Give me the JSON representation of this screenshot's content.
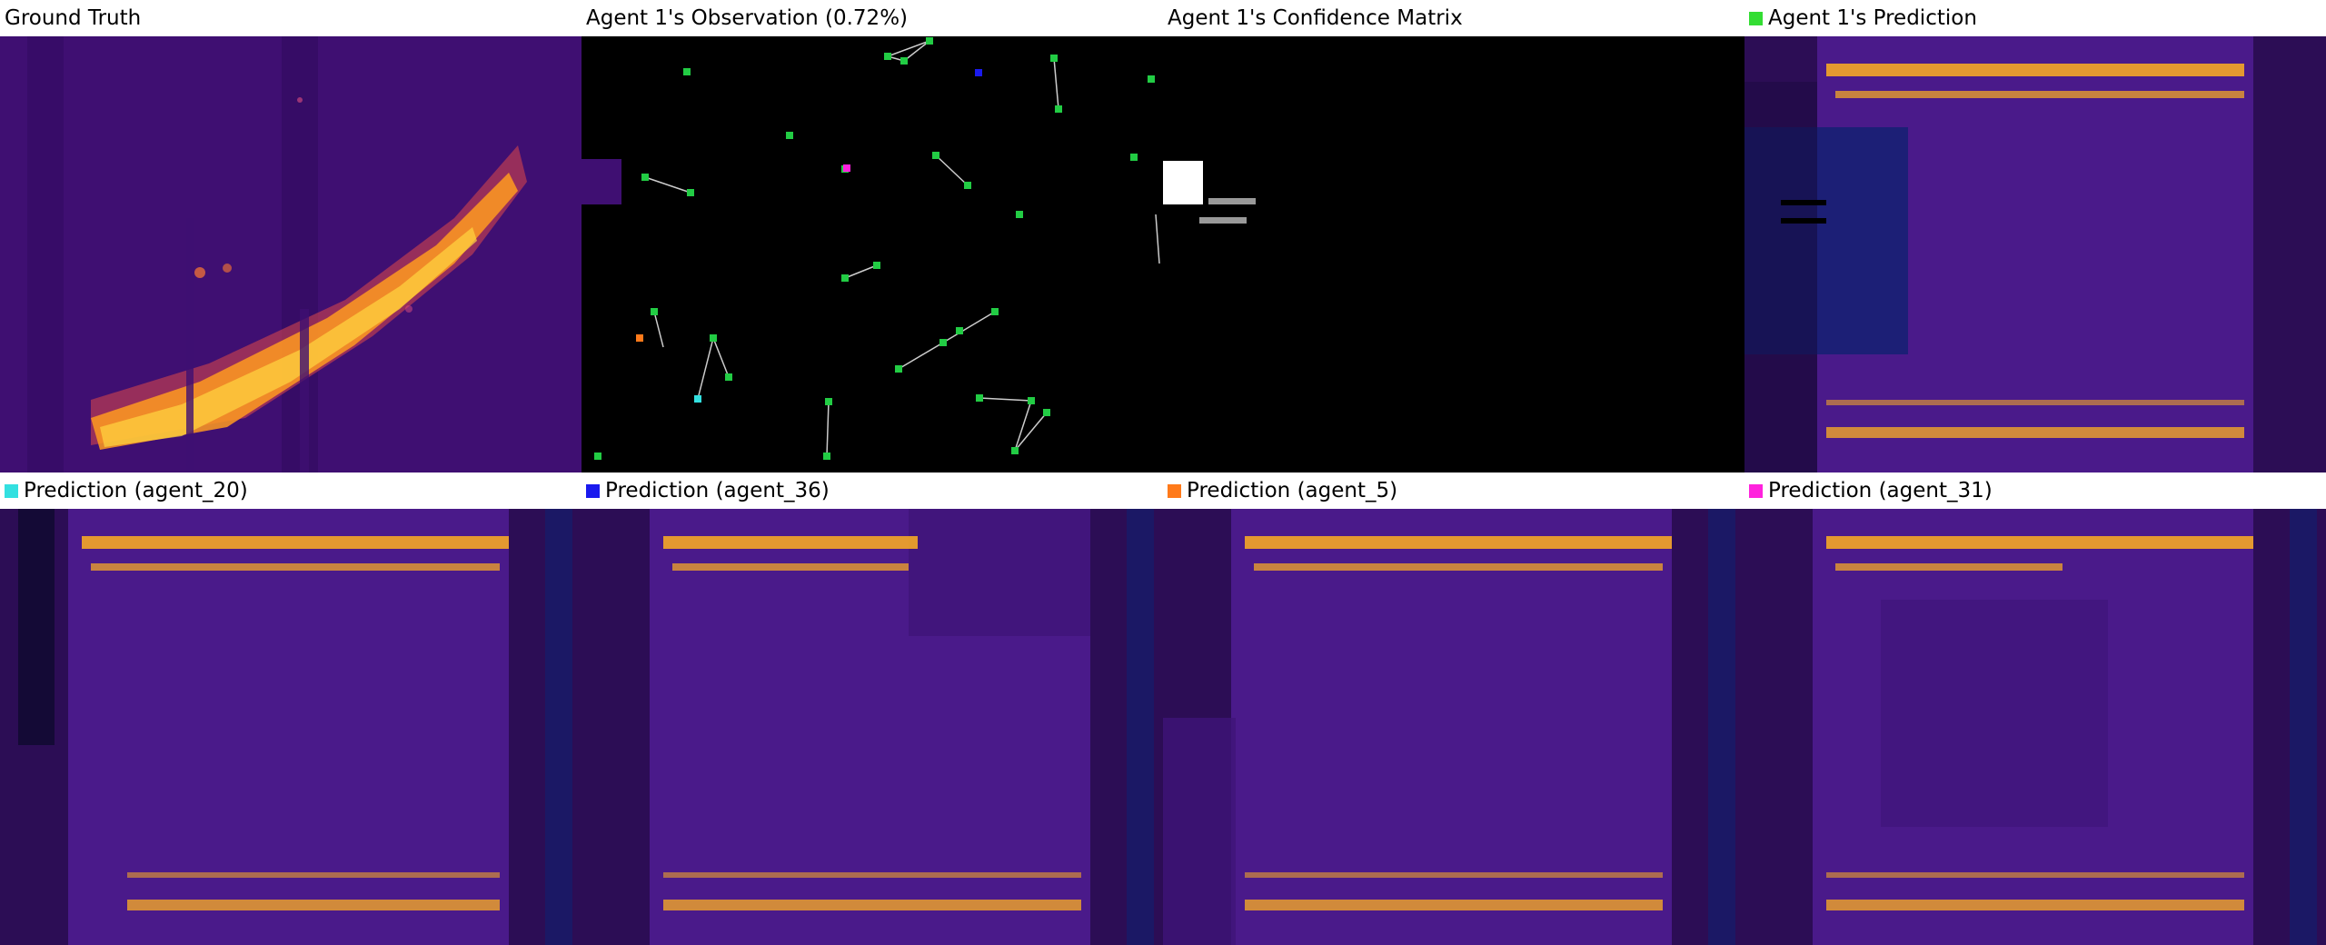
{
  "panels": [
    {
      "title": "Ground Truth",
      "swatch": null,
      "kind": "ground-truth"
    },
    {
      "title": "Agent 1's Observation (0.72%)",
      "swatch": null,
      "kind": "observation"
    },
    {
      "title": "Agent 1's Confidence Matrix",
      "swatch": null,
      "kind": "confidence"
    },
    {
      "title": "Agent 1's Prediction",
      "swatch": "#33dd33",
      "kind": "prediction"
    },
    {
      "title": "Prediction (agent_20)",
      "swatch": "#33e0e0",
      "kind": "prediction"
    },
    {
      "title": "Prediction (agent_36)",
      "swatch": "#1a1aee",
      "kind": "prediction"
    },
    {
      "title": "Prediction (agent_5)",
      "swatch": "#ff7a1a",
      "kind": "prediction"
    },
    {
      "title": "Prediction (agent_31)",
      "swatch": "#ff22dd",
      "kind": "prediction"
    }
  ],
  "colors": {
    "background": "#3f0f72",
    "field": "#4a1a8a",
    "hot": "#ffb020",
    "warm": "#f06030",
    "obs_agent": "#22cc44",
    "obs_link": "#cccccc",
    "confidence_high": "#ffffff",
    "confidence_mid": "#999999"
  }
}
